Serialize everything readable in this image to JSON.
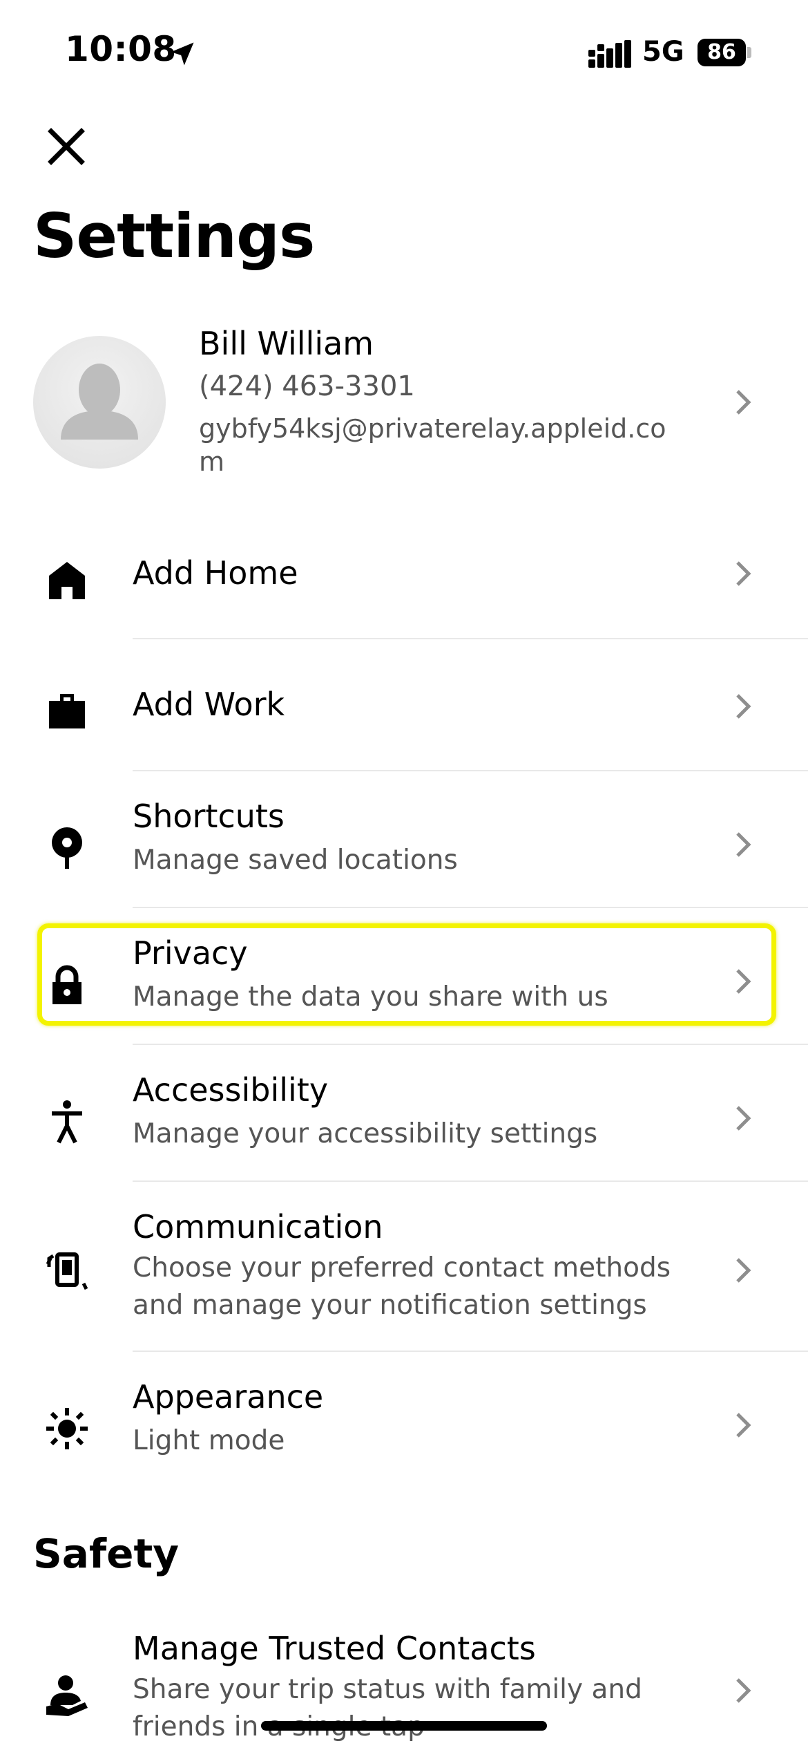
{
  "status_bar": {
    "time": "10:08",
    "network": "5G",
    "battery": "86"
  },
  "page": {
    "title": "Settings"
  },
  "profile": {
    "name": "Bill William",
    "phone": "(424) 463-3301",
    "email": "gybfy54ksj@privaterelay.appleid.com"
  },
  "items": [
    {
      "title": "Add Home",
      "subtitle": "",
      "icon": "home-icon"
    },
    {
      "title": "Add Work",
      "subtitle": "",
      "icon": "briefcase-icon"
    },
    {
      "title": "Shortcuts",
      "subtitle": "Manage saved locations",
      "icon": "location-pin-icon"
    },
    {
      "title": "Privacy",
      "subtitle": "Manage the data you share with us",
      "icon": "lock-icon"
    },
    {
      "title": "Accessibility",
      "subtitle": "Manage your accessibility settings",
      "icon": "accessibility-icon"
    },
    {
      "title": "Communication",
      "subtitle": "Choose your preferred contact methods and manage your notification settings",
      "icon": "phone-notification-icon"
    },
    {
      "title": "Appearance",
      "subtitle": "Light mode",
      "icon": "sun-icon"
    }
  ],
  "safety": {
    "title": "Safety",
    "items": [
      {
        "title": "Manage Trusted Contacts",
        "subtitle": "Share your trip status with family and friends in a single tap",
        "icon": "trusted-contacts-icon"
      }
    ]
  },
  "colors": {
    "highlight": "#f3f300",
    "secondary_text": "#555555",
    "divider": "#e8e8e8",
    "chevron": "#8e8e8e"
  }
}
